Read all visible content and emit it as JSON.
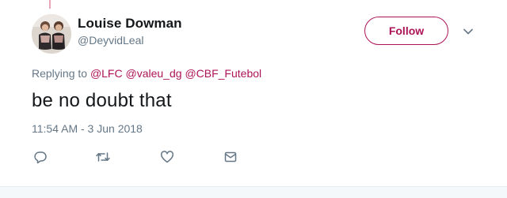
{
  "user": {
    "display_name": "Louise Dowman",
    "handle": "@DeyvidLeal"
  },
  "follow_label": "Follow",
  "reply_context": {
    "prefix": "Replying to",
    "mentions": [
      "@LFC",
      "@valeu_dg",
      "@CBF_Futebol"
    ]
  },
  "tweet": {
    "text": "be no doubt that",
    "timestamp": "11:54 AM - 3 Jun 2018"
  },
  "icons": {
    "avatar": "avatar-image",
    "more": "chevron-down-icon",
    "reply": "reply-icon",
    "retweet": "retweet-icon",
    "like": "heart-icon",
    "dm": "envelope-icon"
  },
  "colors": {
    "accent": "#ad1457",
    "secondary_text": "#657786",
    "primary_text": "#14171a"
  }
}
